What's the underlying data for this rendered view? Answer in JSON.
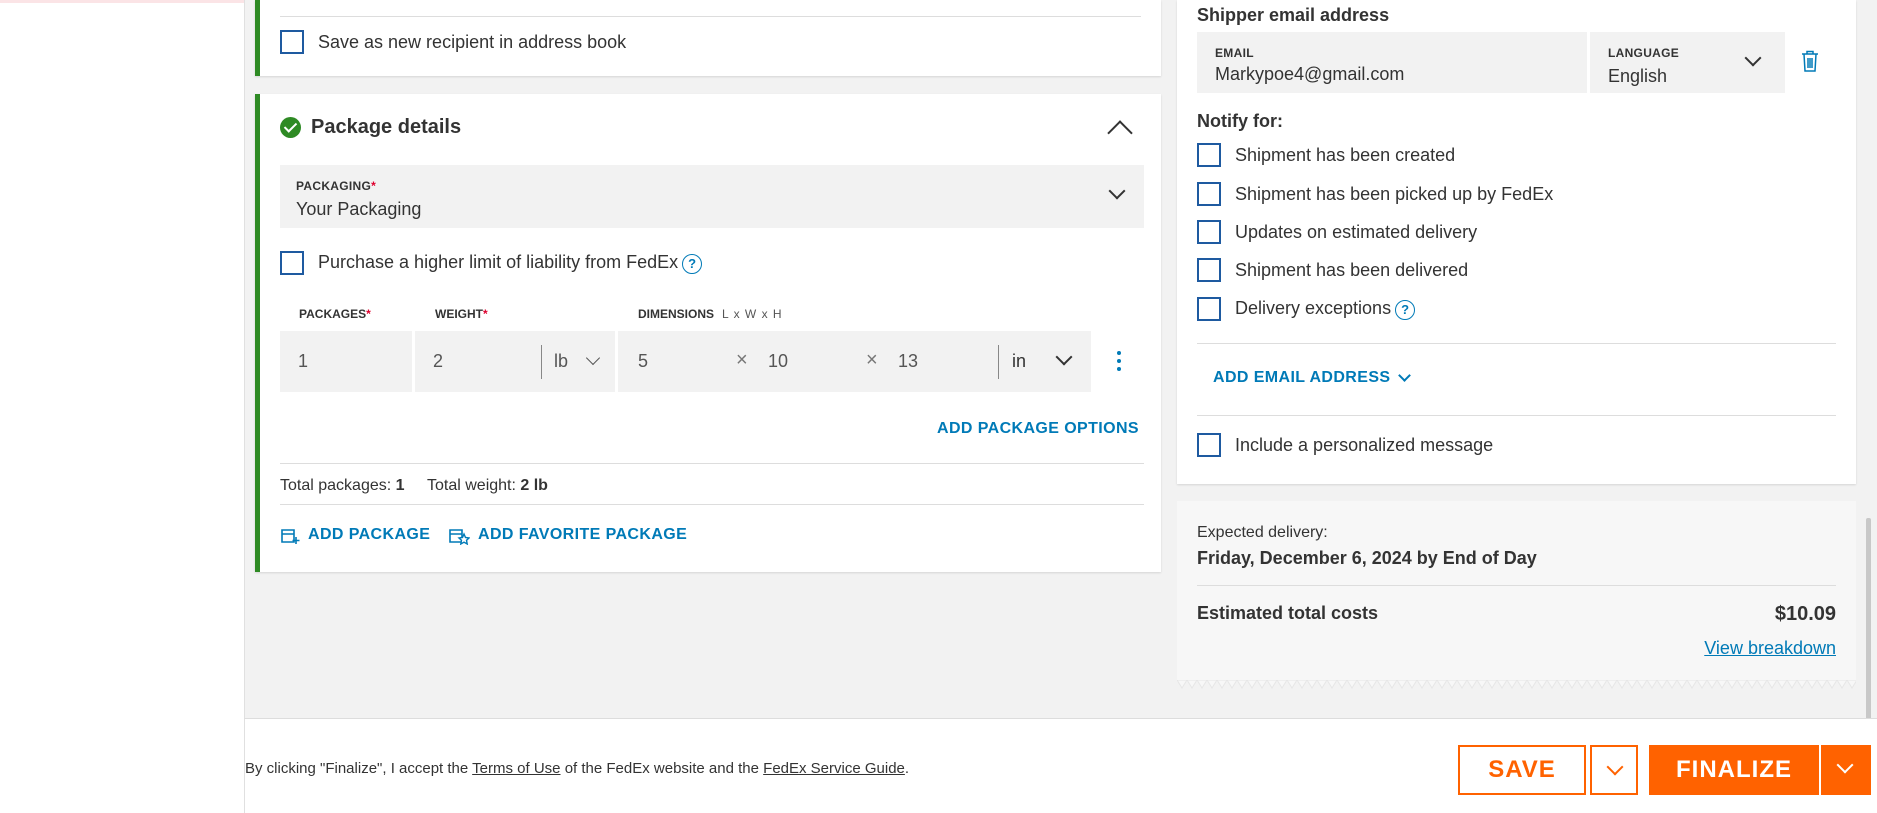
{
  "recipient": {
    "save_address_book_label": "Save as new recipient in address book"
  },
  "package_details": {
    "title": "Package details",
    "packaging_label": "PACKAGING",
    "packaging_value": "Your Packaging",
    "liability_label": "Purchase a higher limit of liability from FedEx",
    "packages_label": "PACKAGES",
    "weight_label": "WEIGHT",
    "dimensions_label": "DIMENSIONS",
    "dimensions_hint": "L x W x H",
    "packages_value": "1",
    "weight_value": "2",
    "weight_unit": "lb",
    "length": "5",
    "width": "10",
    "height": "13",
    "dimension_unit": "in",
    "times_symbol": "×",
    "add_package_options": "ADD PACKAGE OPTIONS",
    "total_packages_label": "Total packages:",
    "total_packages_value": "1",
    "total_weight_label": "Total weight:",
    "total_weight_value": "2 lb",
    "add_package": "ADD PACKAGE",
    "add_favorite_package": "ADD FAVORITE PACKAGE"
  },
  "notifications": {
    "shipper_email_title": "Shipper email address",
    "email_label": "EMAIL",
    "email_value": "Markypoe4@gmail.com",
    "language_label": "LANGUAGE",
    "language_value": "English",
    "notify_for_title": "Notify for:",
    "options": [
      "Shipment has been created",
      "Shipment has been picked up by FedEx",
      "Updates on estimated delivery",
      "Shipment has been delivered",
      "Delivery exceptions"
    ],
    "add_email_address": "ADD EMAIL ADDRESS",
    "personalized_message": "Include a personalized message"
  },
  "delivery": {
    "expected_label": "Expected delivery:",
    "expected_value": "Friday, December 6, 2024 by End of Day",
    "cost_label": "Estimated total costs",
    "cost_value": "$10.09",
    "view_breakdown": "View breakdown"
  },
  "footer": {
    "legal_prefix": "By clicking \"Finalize\", I accept the",
    "terms_link": "Terms of Use",
    "legal_middle": "of the FedEx website and the",
    "guide_link": "FedEx Service Guide",
    "legal_suffix": ".",
    "save_label": "SAVE",
    "finalize_label": "FINALIZE"
  },
  "colors": {
    "accent_link": "#007ab7",
    "success_green": "#2e8a24",
    "fedex_orange": "#ff6200",
    "required_red": "#de002e"
  }
}
